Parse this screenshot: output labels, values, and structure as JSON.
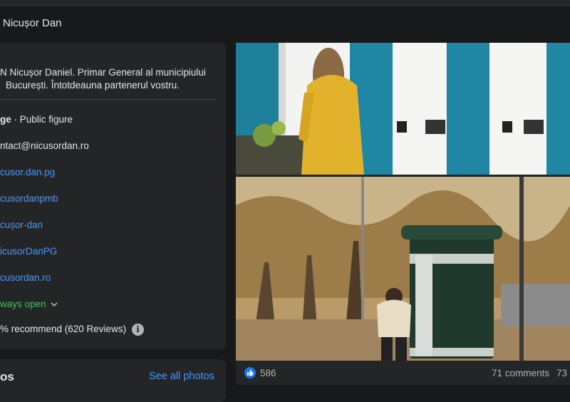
{
  "header": {
    "page_name": "Nicușor Dan"
  },
  "intro": {
    "bio_line1": "N Nicușor Daniel. Primar General al municipiului",
    "bio_line2": "București. Întotdeauna partenerul vostru.",
    "category_bold": "ge",
    "category_rest": " · Public figure",
    "email": "ntact@nicusordan.ro",
    "facebook": "cusor.dan.pg",
    "instagram": "cusordanpmb",
    "linkedin": "cușor-dan",
    "twitter": "icusorDanPG",
    "website": "cusordan.ro",
    "hours": "ways open",
    "rating": "% recommend (620 Reviews)",
    "info_glyph": "i"
  },
  "photos": {
    "title": "os",
    "see_all": "See all photos"
  },
  "post": {
    "likes": "586",
    "comments": "71 comments",
    "shares": "73"
  },
  "colors": {
    "bg": "#18191a",
    "card": "#242526",
    "link": "#4599ff",
    "green": "#45bd62",
    "like": "#1877f2"
  }
}
